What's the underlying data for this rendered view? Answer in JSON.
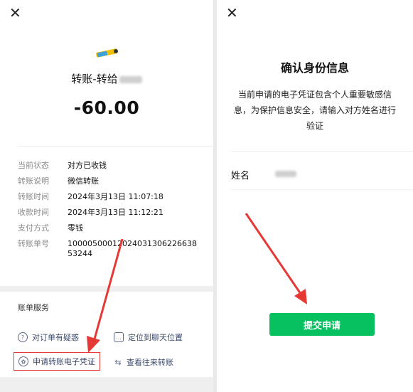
{
  "left": {
    "close_icon": "✕",
    "title": "转账-转给",
    "amount": "-60.00",
    "details": [
      {
        "key": "当前状态",
        "value": "对方已收钱"
      },
      {
        "key": "转账说明",
        "value": "微信转账"
      },
      {
        "key": "转账时间",
        "value": "2024年3月13日 11:07:18"
      },
      {
        "key": "收款时间",
        "value": "2024年3月13日 11:12:21"
      },
      {
        "key": "支付方式",
        "value": "零钱"
      },
      {
        "key": "转账单号",
        "value": "1000050001202403130622663853244"
      }
    ],
    "services_title": "账单服务",
    "services": [
      {
        "label": "对订单有疑惑",
        "icon": "question-icon"
      },
      {
        "label": "定位到聊天位置",
        "icon": "chat-bubble-icon"
      },
      {
        "label": "申请转账电子凭证",
        "icon": "certificate-icon"
      },
      {
        "label": "查看往来转账",
        "icon": "swap-arrows-icon"
      }
    ]
  },
  "right": {
    "close_icon": "✕",
    "title": "确认身份信息",
    "description": "当前申请的电子凭证包含个人重要敏感信息，为保护信息安全，请输入对方姓名进行验证",
    "name_label": "姓名",
    "submit_label": "提交申请"
  },
  "colors": {
    "accent_green": "#07c160",
    "highlight_red": "#e53935",
    "link_blue": "#3a4a6b"
  }
}
